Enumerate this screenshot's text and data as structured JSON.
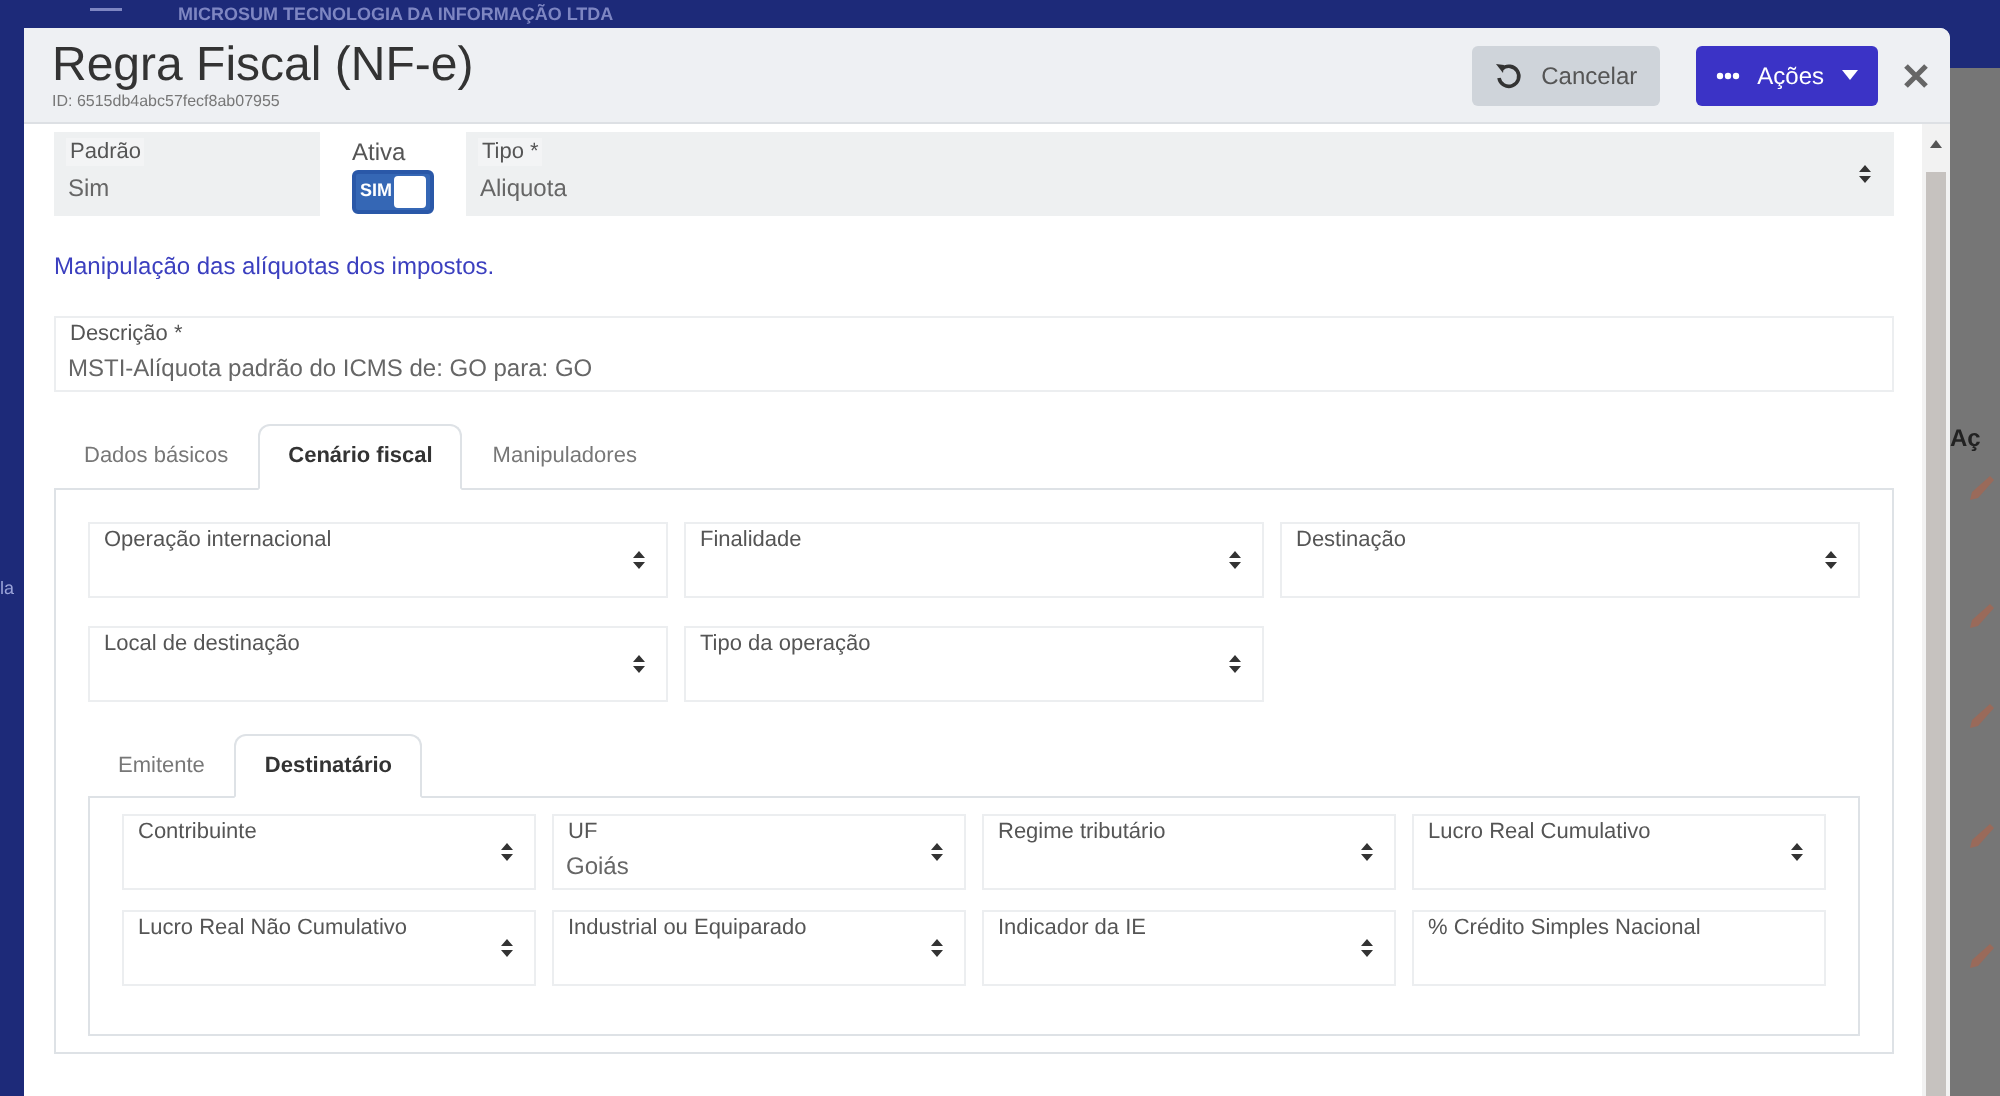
{
  "background": {
    "company": "MICROSUM TECNOLOGIA DA INFORMAÇÃO LTDA",
    "side_text": "la",
    "column_header": "Aç"
  },
  "dialog": {
    "title": "Regra Fiscal (NF-e)",
    "id": "ID: 6515db4abc57fecf8ab07955",
    "buttons": [
      {
        "label": "Cancelar",
        "kind": "cancel"
      },
      {
        "label": "Ações",
        "kind": "actions"
      }
    ]
  },
  "header_fields": [
    {
      "kind": "text",
      "label": "Padrão",
      "value": "Sim",
      "disabled": true
    },
    {
      "kind": "switch",
      "label": "Ativa",
      "text": "SIM",
      "on": true,
      "disabled": false
    },
    {
      "kind": "select",
      "label": "Tipo *",
      "value": "Aliquota",
      "disabled": true
    }
  ],
  "hint": "Manipulação das alíquotas dos impostos.",
  "description": {
    "label": "Descrição *",
    "value": "MSTI-Alíquota padrão do ICMS de: GO para: GO"
  },
  "tabs": [
    {
      "label": "Dados básicos",
      "selected": false
    },
    {
      "label": "Cenário fiscal",
      "selected": true
    },
    {
      "label": "Manipuladores",
      "selected": false
    }
  ],
  "scenario_fields": [
    {
      "kind": "select",
      "label": "Operação internacional"
    },
    {
      "kind": "select",
      "label": "Finalidade"
    },
    {
      "kind": "select",
      "label": "Destinação"
    },
    {
      "kind": "select",
      "label": "Local de destinação"
    },
    {
      "kind": "select",
      "label": "Tipo da operação"
    }
  ],
  "sub_tabs": [
    {
      "label": "Emitente",
      "selected": false
    },
    {
      "label": "Destinatário",
      "selected": true
    }
  ],
  "recipient_fields": [
    {
      "kind": "select",
      "label": "Contribuinte"
    },
    {
      "kind": "select",
      "label": "UF",
      "value": "Goiás"
    },
    {
      "kind": "select",
      "label": "Regime tributário"
    },
    {
      "kind": "select",
      "label": "Lucro Real Cumulativo"
    },
    {
      "kind": "select",
      "label": "Lucro Real Não Cumulativo"
    },
    {
      "kind": "select",
      "label": "Industrial ou Equiparado"
    },
    {
      "kind": "select",
      "label": "Indicador da IE"
    },
    {
      "kind": "text",
      "label": "% Crédito Simples Nacional"
    }
  ]
}
